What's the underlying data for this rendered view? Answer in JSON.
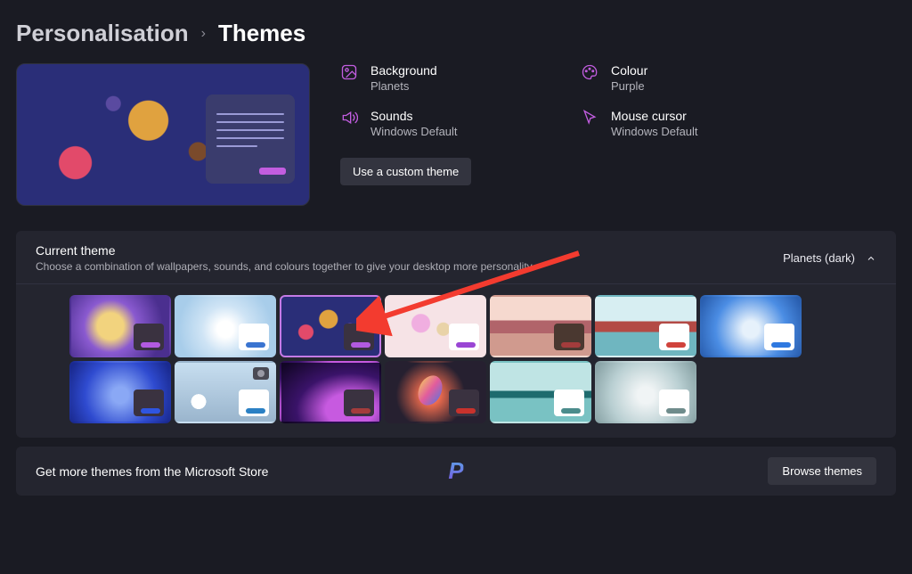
{
  "breadcrumb": {
    "parent": "Personalisation",
    "separator": "›",
    "current": "Themes"
  },
  "properties": {
    "background": {
      "label": "Background",
      "value": "Planets"
    },
    "colour": {
      "label": "Colour",
      "value": "Purple"
    },
    "sounds": {
      "label": "Sounds",
      "value": "Windows Default"
    },
    "cursor": {
      "label": "Mouse cursor",
      "value": "Windows Default"
    }
  },
  "custom_theme_button": "Use a custom theme",
  "current_theme": {
    "title": "Current theme",
    "subtitle": "Choose a combination of wallpapers, sounds, and colours together to give your desktop more personality",
    "selected_label": "Planets (dark)"
  },
  "themes": [
    {
      "card": "dark",
      "pill": "#b25ae0"
    },
    {
      "card": "light",
      "pill": "#3a74d0"
    },
    {
      "card": "dark",
      "pill": "#b25ae0",
      "selected": true
    },
    {
      "card": "light",
      "pill": "#9a46d4"
    },
    {
      "card": "brown",
      "pill": "#a33c3c"
    },
    {
      "card": "light",
      "pill": "#d0433c"
    },
    {
      "card": "light",
      "pill": "#2f79e0"
    },
    {
      "card": "dark",
      "pill": "#2f55e0"
    },
    {
      "card": "light",
      "pill": "#2b80c4"
    },
    {
      "card": "dark",
      "pill": "#a33c3c"
    },
    {
      "card": "dark",
      "pill": "#c8322c"
    },
    {
      "card": "light",
      "pill": "#4b8c8c"
    },
    {
      "card": "light",
      "pill": "#6f8c8c"
    }
  ],
  "store": {
    "text": "Get more themes from the Microsoft Store",
    "browse": "Browse themes",
    "logo_text": "P"
  },
  "accent": "#c25de0"
}
